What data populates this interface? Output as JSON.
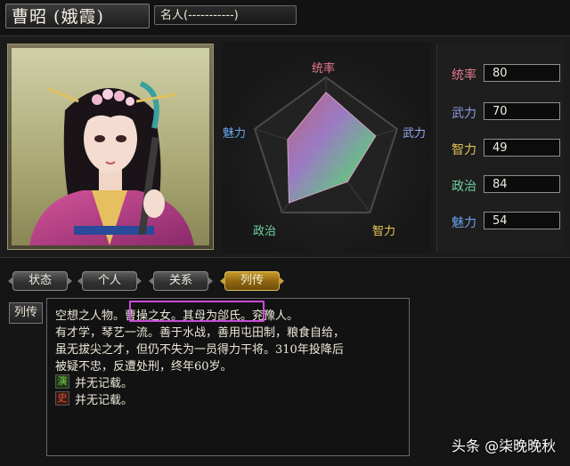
{
  "header": {
    "name": "曹昭 (娥霞)",
    "fame": "名人(-----------)"
  },
  "radar": {
    "labels": {
      "top": "统率",
      "right": "武力",
      "bottom_right": "智力",
      "bottom_left": "政治",
      "left": "魅力"
    },
    "values": [
      80,
      70,
      49,
      84,
      54
    ]
  },
  "stats": [
    {
      "label": "统率",
      "value": "80",
      "color": "#e07a8c"
    },
    {
      "label": "武力",
      "value": "70",
      "color": "#8a9ae0"
    },
    {
      "label": "智力",
      "value": "49",
      "color": "#e0c050"
    },
    {
      "label": "政治",
      "value": "84",
      "color": "#6fd0a0"
    },
    {
      "label": "魅力",
      "value": "54",
      "color": "#6aa0e8"
    }
  ],
  "tabs": [
    {
      "label": "状态",
      "active": false
    },
    {
      "label": "个人",
      "active": false
    },
    {
      "label": "关系",
      "active": false
    },
    {
      "label": "列传",
      "active": true
    }
  ],
  "biography": {
    "label": "列传",
    "lines": [
      "空想之人物。曹操之女。其母为郃氏。兖豫人。",
      "有才学，琴艺一流。善于水战，善用屯田制，粮食自给，",
      "虽无拔尖之才，但仍不失为一员得力干将。310年投降后",
      "被疑不忠，反遭处刑，终年60岁。"
    ],
    "notes": [
      {
        "icon": "演",
        "text": "并无记载。",
        "color": "#7fd05a"
      },
      {
        "icon": "史",
        "text": "并无记载。",
        "color": "#e0553a"
      }
    ]
  },
  "watermark": "头条 @柒晚晚秋"
}
